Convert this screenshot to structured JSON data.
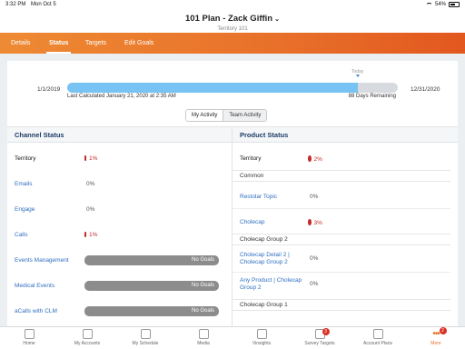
{
  "status_bar": {
    "time": "3:32 PM",
    "date": "Mon Oct 5",
    "battery": "54%"
  },
  "header": {
    "title": "101 Plan - Zack Giffin",
    "subtitle": "Territory 101"
  },
  "tabs": [
    {
      "label": "Details"
    },
    {
      "label": "Status"
    },
    {
      "label": "Targets"
    },
    {
      "label": "Edit Goals"
    }
  ],
  "timeline": {
    "start": "1/1/2019",
    "end": "12/31/2020",
    "today_label": "Today",
    "progress": 0.88,
    "last_calculated": "Last Calculated January 21, 2020 at 2:35 AM",
    "remaining": "88 Days Remaining"
  },
  "activity_toggle": {
    "mine": "My Activity",
    "team": "Team Activity"
  },
  "channel_status": {
    "title": "Channel Status",
    "rows": [
      {
        "label": "Territory",
        "value": "1%"
      },
      {
        "label": "Emails",
        "value": "0%"
      },
      {
        "label": "Engage",
        "value": "0%"
      },
      {
        "label": "Calls",
        "value": "1%"
      },
      {
        "label": "Events Management",
        "value": "No Goals"
      },
      {
        "label": "Medical Events",
        "value": "No Goals"
      },
      {
        "label": "aCalls with CLM",
        "value": "No Goals"
      }
    ]
  },
  "product_status": {
    "title": "Product Status",
    "territory": {
      "label": "Territory",
      "value": "2%"
    },
    "groups": [
      {
        "label": "Common"
      },
      {
        "label": "Cholecap Group 2"
      },
      {
        "label": "Cholecap Group 1"
      }
    ],
    "rows": [
      {
        "label": "Restolar Topic",
        "value": "0%"
      },
      {
        "label": "Cholecap",
        "value": "3%"
      },
      {
        "label": "Cholecap Detail 2 | Cholecap Group 2",
        "value": "0%"
      },
      {
        "label": "Any Product | Cholecap Group 2",
        "value": "0%"
      }
    ]
  },
  "bottom_nav": [
    {
      "label": "Home"
    },
    {
      "label": "My Accounts"
    },
    {
      "label": "My Schedule"
    },
    {
      "label": "Media"
    },
    {
      "label": "Vinsights"
    },
    {
      "label": "Survey Targets",
      "badge": "3"
    },
    {
      "label": "Account Plans"
    },
    {
      "label": "More",
      "badge": "2"
    }
  ]
}
